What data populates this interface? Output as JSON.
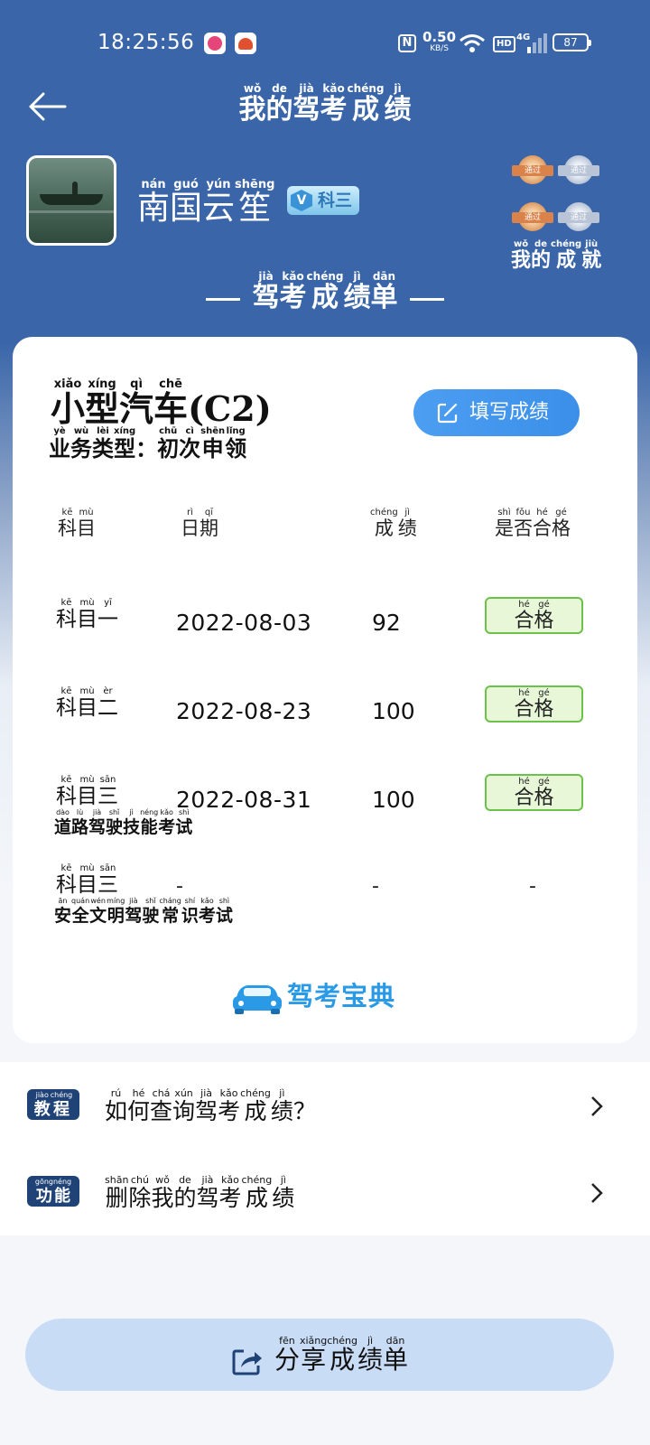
{
  "status_bar": {
    "time": "18:25:56",
    "speed_value": "0.50",
    "speed_unit": "KB/S",
    "hd": "HD",
    "network": "4G",
    "battery": "87"
  },
  "header": {
    "title": [
      [
        "wǒ",
        "我"
      ],
      [
        "de",
        "的"
      ],
      [
        "jià",
        "驾"
      ],
      [
        "kǎo",
        "考"
      ],
      [
        "chéng",
        "成"
      ],
      [
        "jì",
        "绩"
      ]
    ]
  },
  "profile": {
    "name": [
      [
        "nán",
        "南"
      ],
      [
        "guó",
        "国"
      ],
      [
        "yún",
        "云"
      ],
      [
        "shēng",
        "笙"
      ]
    ],
    "level_badge": "科三",
    "medal_label": "通过",
    "achievements": [
      [
        "wǒ",
        "我"
      ],
      [
        "de",
        "的"
      ],
      [
        "chéng",
        "成"
      ],
      [
        "jiù",
        "就"
      ]
    ]
  },
  "sheet_title": [
    [
      "jià",
      "驾"
    ],
    [
      "kǎo",
      "考"
    ],
    [
      "chéng",
      "成"
    ],
    [
      "jì",
      "绩"
    ],
    [
      "dān",
      "单"
    ]
  ],
  "card": {
    "car_type": [
      [
        "xiǎo",
        "小"
      ],
      [
        "xíng",
        "型"
      ],
      [
        "qì",
        "汽"
      ],
      [
        "chē",
        "车"
      ],
      [
        "",
        "(C2)"
      ]
    ],
    "business": [
      [
        "yè",
        "业"
      ],
      [
        "wù",
        "务"
      ],
      [
        "lèi",
        "类"
      ],
      [
        "xíng",
        "型"
      ],
      [
        "",
        "："
      ],
      [
        "chū",
        "初"
      ],
      [
        "cì",
        "次"
      ],
      [
        "shēn",
        "申"
      ],
      [
        "lǐng",
        "领"
      ]
    ],
    "fill_button": "填写成绩",
    "headers": {
      "subject": [
        [
          "kē",
          "科"
        ],
        [
          "mù",
          "目"
        ]
      ],
      "date": [
        [
          "rì",
          "日"
        ],
        [
          "qī",
          "期"
        ]
      ],
      "score": [
        [
          "chéng",
          "成"
        ],
        [
          "jì",
          "绩"
        ]
      ],
      "passed": [
        [
          "shì",
          "是"
        ],
        [
          "fǒu",
          "否"
        ],
        [
          "hé",
          "合"
        ],
        [
          "gé",
          "格"
        ]
      ]
    },
    "rows": [
      {
        "subject": [
          [
            "kē",
            "科"
          ],
          [
            "mù",
            "目"
          ],
          [
            "yī",
            "一"
          ]
        ],
        "sub": [],
        "date": "2022-08-03",
        "score": "92",
        "status": [
          [
            "hé",
            "合"
          ],
          [
            "gé",
            "格"
          ]
        ]
      },
      {
        "subject": [
          [
            "kē",
            "科"
          ],
          [
            "mù",
            "目"
          ],
          [
            "èr",
            "二"
          ]
        ],
        "sub": [],
        "date": "2022-08-23",
        "score": "100",
        "status": [
          [
            "hé",
            "合"
          ],
          [
            "gé",
            "格"
          ]
        ]
      },
      {
        "subject": [
          [
            "kē",
            "科"
          ],
          [
            "mù",
            "目"
          ],
          [
            "sān",
            "三"
          ]
        ],
        "sub": [
          [
            "dào",
            "道"
          ],
          [
            "lù",
            "路"
          ],
          [
            "jià",
            "驾"
          ],
          [
            "shǐ",
            "驶"
          ],
          [
            "jì",
            "技"
          ],
          [
            "néng",
            "能"
          ],
          [
            "kǎo",
            "考"
          ],
          [
            "shì",
            "试"
          ]
        ],
        "date": "2022-08-31",
        "score": "100",
        "status": [
          [
            "hé",
            "合"
          ],
          [
            "gé",
            "格"
          ]
        ]
      },
      {
        "subject": [
          [
            "kē",
            "科"
          ],
          [
            "mù",
            "目"
          ],
          [
            "sān",
            "三"
          ]
        ],
        "sub": [
          [
            "ān",
            "安"
          ],
          [
            "quán",
            "全"
          ],
          [
            "wén",
            "文"
          ],
          [
            "míng",
            "明"
          ],
          [
            "jià",
            "驾"
          ],
          [
            "shǐ",
            "驶"
          ],
          [
            "cháng",
            "常"
          ],
          [
            "shí",
            "识"
          ],
          [
            "kǎo",
            "考"
          ],
          [
            "shì",
            "试"
          ]
        ],
        "date": "-",
        "score": "-",
        "status": "-"
      }
    ],
    "brand": "驾考宝典"
  },
  "links": [
    {
      "tag": [
        [
          "jiào",
          "教"
        ],
        [
          "chéng",
          "程"
        ]
      ],
      "text": [
        [
          "rú",
          "如"
        ],
        [
          "hé",
          "何"
        ],
        [
          "chá",
          "查"
        ],
        [
          "xún",
          "询"
        ],
        [
          "jià",
          "驾"
        ],
        [
          "kǎo",
          "考"
        ],
        [
          "chéng",
          "成"
        ],
        [
          "jì",
          "绩"
        ],
        [
          "",
          "？"
        ]
      ]
    },
    {
      "tag": [
        [
          "gōng",
          "功"
        ],
        [
          "néng",
          "能"
        ]
      ],
      "text": [
        [
          "shān",
          "删"
        ],
        [
          "chú",
          "除"
        ],
        [
          "wǒ",
          "我"
        ],
        [
          "de",
          "的"
        ],
        [
          "jià",
          "驾"
        ],
        [
          "kǎo",
          "考"
        ],
        [
          "chéng",
          "成"
        ],
        [
          "jì",
          "绩"
        ]
      ]
    }
  ],
  "share_button": [
    [
      "fēn",
      "分"
    ],
    [
      "xiǎng",
      "享"
    ],
    [
      "chéng",
      "成"
    ],
    [
      "jì",
      "绩"
    ],
    [
      "dān",
      "单"
    ]
  ],
  "colors": {
    "header_blue": "#3a66a9",
    "accent_blue": "#3b8fe8",
    "pass_green": "#6cc14b",
    "tag_navy": "#1f4277",
    "share_bg": "#c9dcf6"
  }
}
